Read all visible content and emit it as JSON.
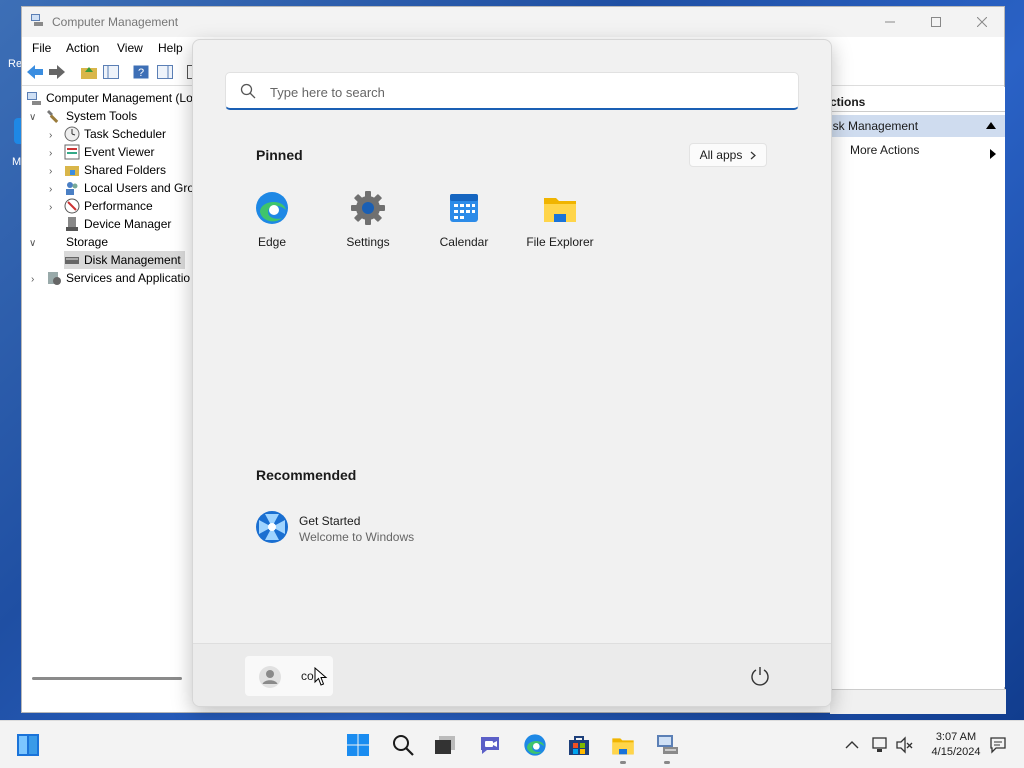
{
  "desktop": {
    "frag1": "Re",
    "frag2": "M"
  },
  "window": {
    "title": "Computer Management",
    "menu": [
      "File",
      "Action",
      "View",
      "Help"
    ],
    "tree": [
      {
        "label": "Computer Management (Lo",
        "level": 0
      },
      {
        "label": "System Tools",
        "level": 1
      },
      {
        "label": "Task Scheduler",
        "level": 2
      },
      {
        "label": "Event Viewer",
        "level": 2
      },
      {
        "label": "Shared Folders",
        "level": 2
      },
      {
        "label": "Local Users and Grou",
        "level": 2
      },
      {
        "label": "Performance",
        "level": 2
      },
      {
        "label": "Device Manager",
        "level": 2
      },
      {
        "label": "Storage",
        "level": 1
      },
      {
        "label": "Disk Management",
        "level": 2,
        "selected": true
      },
      {
        "label": "Services and Applicatio",
        "level": 1
      }
    ],
    "actions": {
      "header": "ctions",
      "sub": "isk Management",
      "more": "More Actions"
    }
  },
  "start": {
    "search_placeholder": "Type here to search",
    "pinned_title": "Pinned",
    "all_apps": "All apps",
    "pinned": [
      {
        "label": "Edge",
        "icon": "edge-icon"
      },
      {
        "label": "Settings",
        "icon": "settings-icon"
      },
      {
        "label": "Calendar",
        "icon": "calendar-icon"
      },
      {
        "label": "File Explorer",
        "icon": "file-explorer-icon"
      }
    ],
    "recommended_title": "Recommended",
    "recommended": [
      {
        "title": "Get Started",
        "subtitle": "Welcome to Windows",
        "icon": "get-started-icon"
      }
    ],
    "user_name": "co"
  },
  "taskbar": {
    "time": "3:07 AM",
    "date": "4/15/2024",
    "icons": [
      "windows-start-icon",
      "search-icon",
      "task-view-icon",
      "chat-icon",
      "edge-icon",
      "store-icon",
      "file-explorer-icon",
      "computer-management-icon"
    ]
  },
  "colors": {
    "accent": "#1a5fb4",
    "selection": "#cfdcef"
  }
}
